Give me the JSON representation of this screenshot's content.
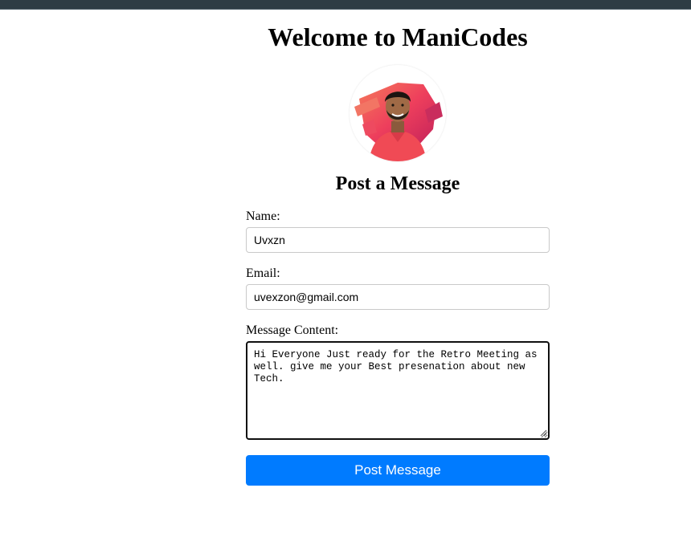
{
  "header": {
    "title": "Welcome to ManiCodes"
  },
  "avatar": {
    "icon": "avatar-photo",
    "accent": "#f03e4f"
  },
  "form": {
    "title": "Post a Message",
    "name_label": "Name:",
    "name_value": "Uvxzn",
    "email_label": "Email:",
    "email_value": "uvexzon@gmail.com",
    "message_label": "Message Content:",
    "message_value": "Hi Everyone Just ready for the Retro Meeting as well. give me your Best presenation about new Tech.",
    "submit_label": "Post Message"
  },
  "colors": {
    "button": "#007bff",
    "top_bar": "#2e3d44"
  }
}
